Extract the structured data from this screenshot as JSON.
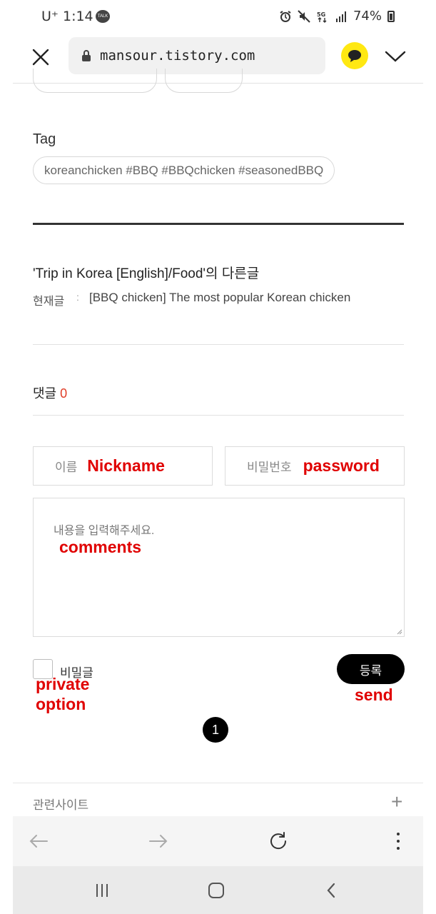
{
  "status_bar": {
    "carrier": "U⁺ 1:14",
    "talk_badge": "TALK",
    "battery": "74%"
  },
  "browser": {
    "url": "mansour.tistory.com"
  },
  "tag_section": {
    "title": "Tag",
    "tags": "koreanchicken #BBQ #BBQchicken #seasonedBBQ"
  },
  "related": {
    "title": "'Trip in Korea [English]/Food'의 다른글",
    "current_label": "현재글",
    "separator": ":",
    "current_post": "[BBQ chicken] The most popular Korean chicken"
  },
  "comments": {
    "label": "댓글",
    "count": "0",
    "name_placeholder": "이름",
    "password_placeholder": "비밀번호",
    "content_placeholder": "내용을 입력해주세요.",
    "private_label": "비밀글",
    "submit_label": "등록"
  },
  "annotations": {
    "nickname": "Nickname",
    "password": "password",
    "comments": "comments",
    "private": "private\noption",
    "send": "send"
  },
  "pagination": {
    "current_page": "1"
  },
  "footer": {
    "related_sites": "관련사이트",
    "plus": "+"
  },
  "colors": {
    "accent_red": "#e00000",
    "count_red": "#e03c26",
    "kakao_yellow": "#ffe812"
  }
}
